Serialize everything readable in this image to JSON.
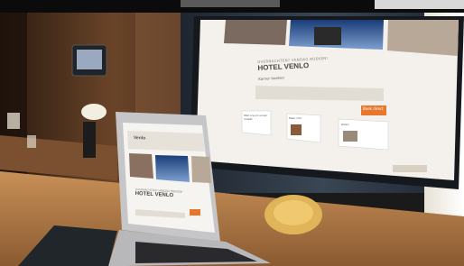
{
  "screen": {
    "eyebrow": "OVERNACHTEN? VANDAG BOEKEN!",
    "hotel_name": "HOTEL VENLO",
    "form_title": "Kamer boeken",
    "book_button": "Boek direct",
    "card_1_title": "Wat ons zo uniek maakt",
    "card_2_title": "Meer info",
    "card_3_title": "Zalen"
  },
  "laptop": {
    "logo": "Venlo",
    "eyebrow": "OVERNACHTEN? VANDAG BOEKEN!",
    "hotel_name": "HOTEL VENLO"
  },
  "colors": {
    "accent_orange": "#e8772e",
    "wall_brown": "#5a3a22",
    "desk_wood": "#b07a45",
    "curtain": "#2b3440",
    "chair_yellow": "#e0b55a"
  }
}
